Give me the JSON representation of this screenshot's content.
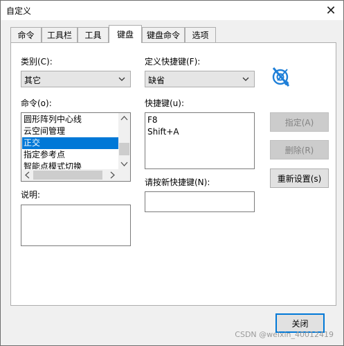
{
  "window": {
    "title": "自定义"
  },
  "tabs": [
    {
      "label": "命令",
      "active": false
    },
    {
      "label": "工具栏",
      "active": false
    },
    {
      "label": "工具",
      "active": false
    },
    {
      "label": "键盘",
      "active": true
    },
    {
      "label": "键盘命令",
      "active": false
    },
    {
      "label": "选项",
      "active": false
    }
  ],
  "category": {
    "label": "类别(C):",
    "value": "其它"
  },
  "commands": {
    "label": "命令(o):",
    "items": [
      "圆形阵列中心线",
      "云空间管理",
      "正交",
      "指定参考点",
      "智能点模式切换"
    ],
    "selected": "正交"
  },
  "description": {
    "label": "说明:",
    "value": ""
  },
  "shortcut_set": {
    "label": "定义快捷键(F):",
    "value": "缺省"
  },
  "shortcuts": {
    "label": "快捷键(u):",
    "items": [
      "F8",
      "Shift+A"
    ]
  },
  "new_shortcut": {
    "label": "请按新快捷键(N):",
    "value": ""
  },
  "buttons": {
    "assign": "指定(A)",
    "delete": "删除(R)",
    "reset": "重新设置(s)",
    "close": "关闭"
  },
  "watermark": "CSDN @weixin_40012419",
  "colors": {
    "selection": "#0078d7",
    "logo": "#1e7fd8"
  },
  "icons": {
    "app_logo": "app-logo-icon",
    "close": "close-icon"
  }
}
